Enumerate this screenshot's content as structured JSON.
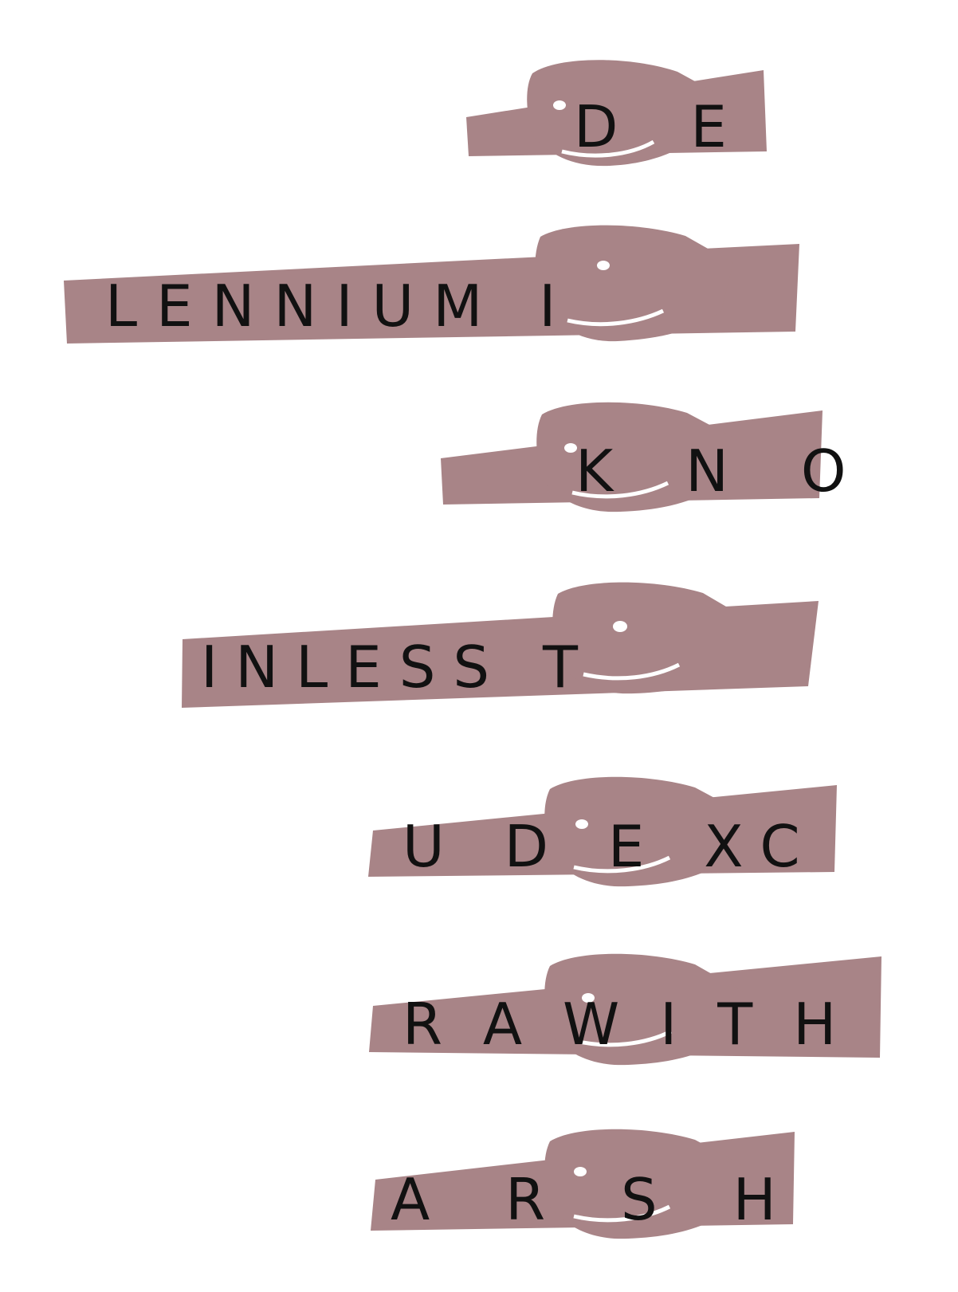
{
  "colors": {
    "band": "#a88487",
    "blob": "#a88487",
    "ink": "#111111",
    "background": "#ffffff"
  },
  "rows": [
    {
      "label": "row-1",
      "text": "D E"
    },
    {
      "label": "row-2",
      "text": "LENNIUM I"
    },
    {
      "label": "row-3",
      "text": "K N O"
    },
    {
      "label": "row-4",
      "text": "INLESS T"
    },
    {
      "label": "row-5",
      "text": "U D E XC"
    },
    {
      "label": "row-6",
      "text": "R A W I T H"
    },
    {
      "label": "row-7",
      "text": "A R S H"
    }
  ]
}
